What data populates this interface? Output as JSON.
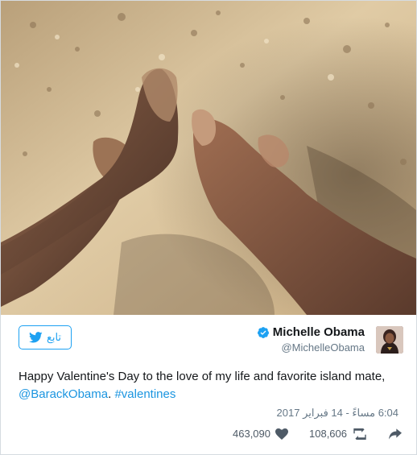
{
  "photo": {
    "description_icon": "beach-feet-photo"
  },
  "header": {
    "display_name": "Michelle Obama",
    "handle": "@MichelleObama",
    "verified_icon": "verified-badge-icon",
    "follow_label": "تابع",
    "follow_icon": "twitter-bird-icon"
  },
  "tweet": {
    "text_before": "Happy Valentine's Day to the love of my life and favorite island mate, ",
    "mention": "@BarackObama",
    "text_mid": ". ",
    "hashtag": "#valentines"
  },
  "meta": {
    "timestamp": "6:04 مساءً - 14 فبراير 2017"
  },
  "actions": {
    "likes": "463,090",
    "retweets": "108,606",
    "like_icon": "heart-icon",
    "retweet_icon": "retweet-icon",
    "share_icon": "share-arrow-icon"
  },
  "colors": {
    "brand": "#1da1f2",
    "link": "#1b95e0",
    "sand": "#d8c19a"
  }
}
